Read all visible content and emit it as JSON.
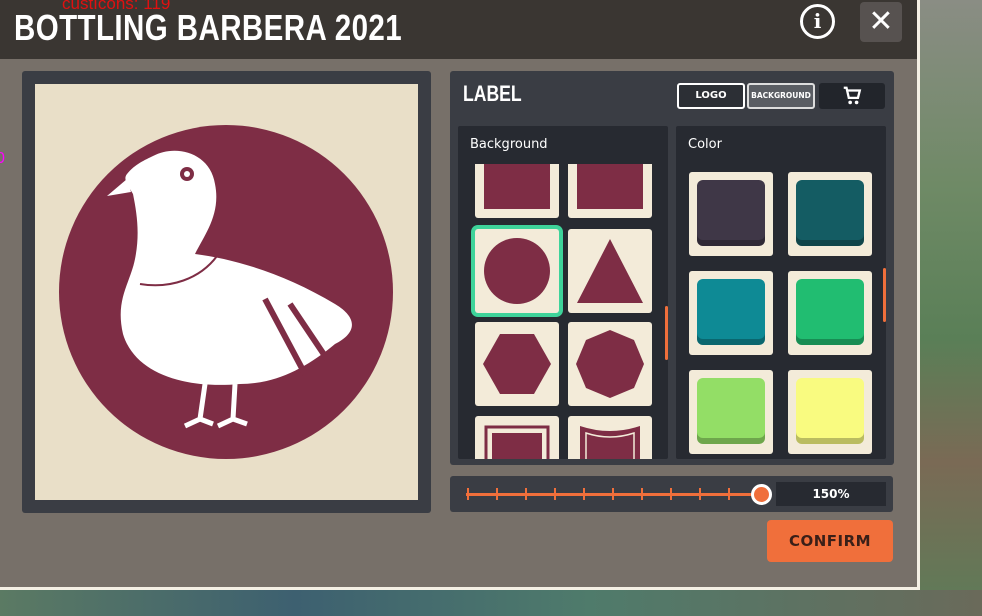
{
  "debug": {
    "overlay_text": "custIcons: 119",
    "left_text": "0"
  },
  "window": {
    "title": "BOTTLING BARBERA 2021",
    "info_icon": "info-icon",
    "close_icon": "close-icon",
    "close_glyph": "✕",
    "info_glyph": "i"
  },
  "label_panel": {
    "title": "LABEL",
    "tabs": {
      "logo": "LOGO",
      "background": "BACKGROUND"
    },
    "cart_icon": "cart-icon",
    "background_column": {
      "header": "Background",
      "shapes": [
        "square",
        "square",
        "circle",
        "triangle",
        "hexagon",
        "octagon",
        "frame",
        "banner"
      ],
      "selected": "circle"
    },
    "color_column": {
      "header": "Color",
      "colors": [
        "#3f3747",
        "#145c63",
        "#0e8a95",
        "#21bd71",
        "#93de66",
        "#f9fb80"
      ]
    }
  },
  "preview": {
    "shape": "circle",
    "shape_color": "#7e2d45",
    "bg_color": "#e9dfc8",
    "logo_icon": "pigeon-icon"
  },
  "zoom": {
    "value": "150%",
    "level": 1.0
  },
  "confirm": {
    "label": "CONFIRM"
  },
  "colors": {
    "accent": "#f06f3b",
    "selection": "#3ed39a",
    "panel": "#3a3d44"
  }
}
